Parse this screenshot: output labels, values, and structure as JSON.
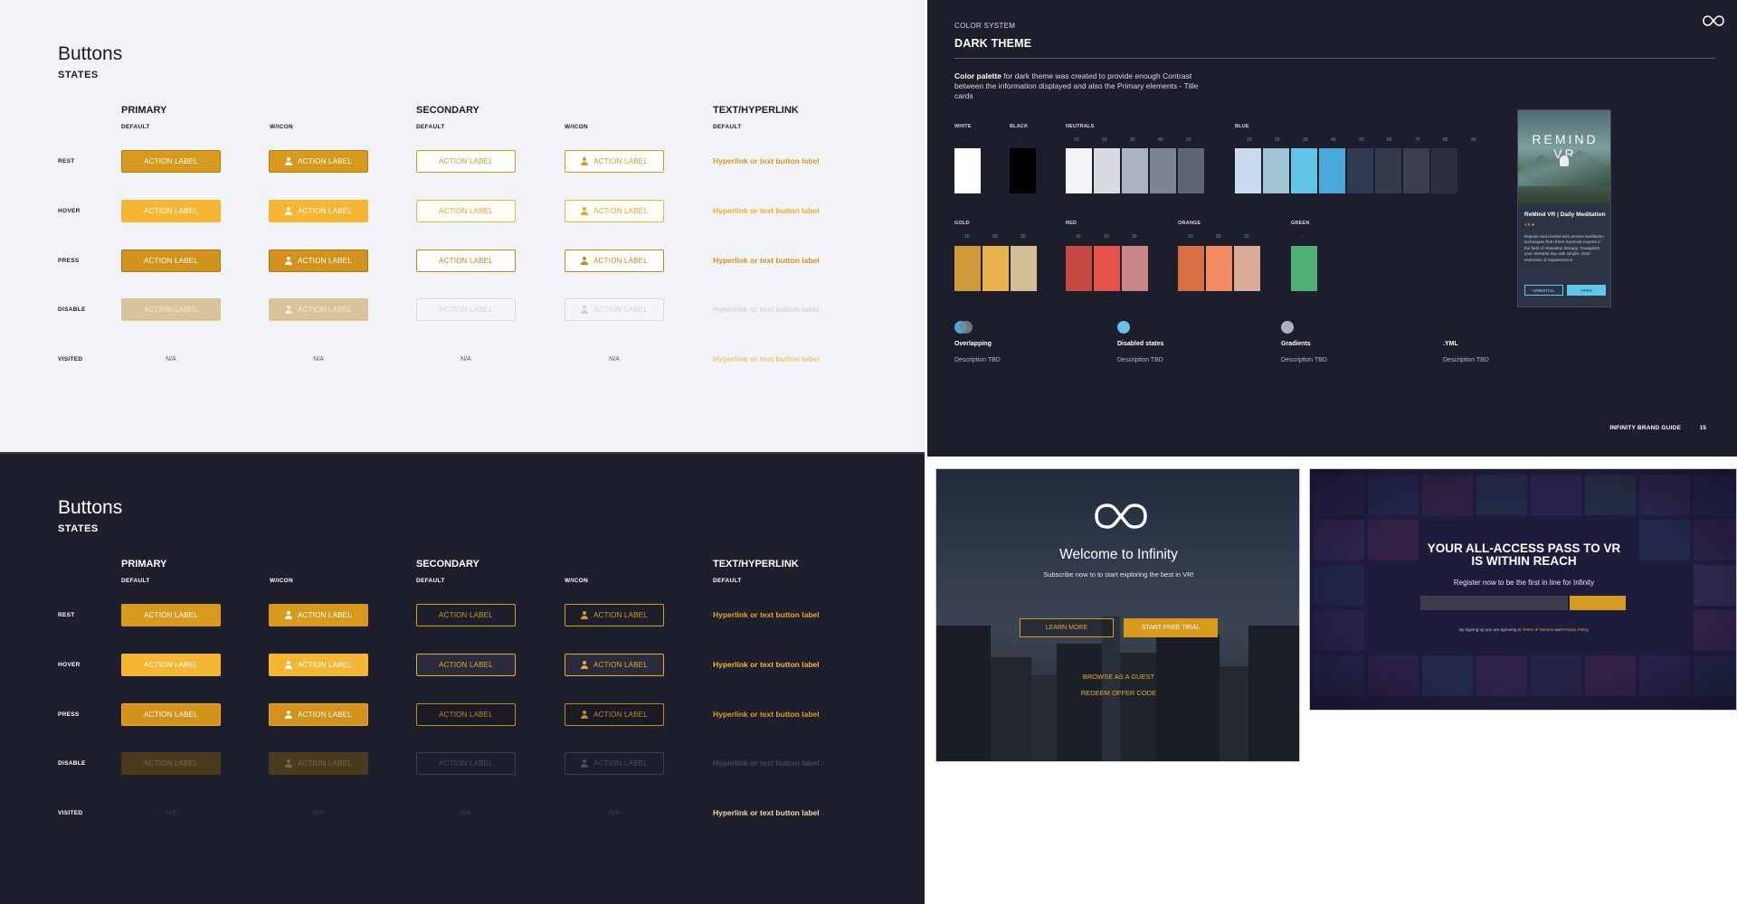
{
  "buttons_light": {
    "title": "Buttons",
    "subtitle": "STATES",
    "columns": {
      "primary": "PRIMARY",
      "primary_default": "DEFAULT",
      "primary_icon": "W/ICON",
      "secondary": "SECONDARY",
      "secondary_default": "DEFAULT",
      "secondary_icon": "W/ICON",
      "text": "TEXT/HYPERLINK",
      "text_default": "DEFAULT"
    },
    "rows": {
      "rest": "REST",
      "hover": "HOVER",
      "press": "PRESS",
      "disable": "DISABLE",
      "visited": "VISITED"
    },
    "action_label": "ACTION LABEL",
    "link_label": "Hyperlink or text button label",
    "na": "N/A"
  },
  "buttons_dark": {
    "title": "Buttons",
    "subtitle": "STATES",
    "columns": {
      "primary": "PRIMARY",
      "primary_default": "DEFAULT",
      "primary_icon": "W/ICON",
      "secondary": "SECONDARY",
      "secondary_default": "DEFAULT",
      "secondary_icon": "W/ICON",
      "text": "TEXT/HYPERLINK",
      "text_default": "DEFAULT"
    },
    "rows": {
      "rest": "REST",
      "hover": "HOVER",
      "press": "PRESS",
      "disable": "DISABLE",
      "visited": "VISITED"
    },
    "action_label": "ACTION LABEL",
    "link_label": "Hyperlink or text button label",
    "na": "N/A"
  },
  "color_system": {
    "kicker": "COLOR SYSTEM",
    "title": "DARK THEME",
    "desc_bold": "Color palette",
    "desc_rest": " for dark theme was created to provide enough Contrast between the information displayed and also the Primary elements - Title cards",
    "groups": {
      "white": "WHITE",
      "black": "BLACK",
      "neutrals": "NEUTRALS",
      "blue": "BLUE",
      "gold": "GOLD",
      "red": "RED",
      "orange": "ORANGE",
      "green": "GREEN"
    },
    "ticks": {
      "dash": "-",
      "t10": "10",
      "t20": "20",
      "t30": "30",
      "t40": "40",
      "t50": "50",
      "t60": "60",
      "t70": "70",
      "t80": "80",
      "t90": "90"
    },
    "colors": {
      "white": "#ffffff",
      "black": "#000000",
      "neutrals": [
        "#f4f5f8",
        "#d9dbe2",
        "#a9b2bf",
        "#7b8592",
        "#5c6573"
      ],
      "blue": [
        "#c9dcef",
        "#a1c4d2",
        "#63c4e8",
        "#4aa9d9",
        "#2e3a4f",
        "#333a4b",
        "#3b3e4e",
        "#2d2f3e"
      ],
      "gold": [
        "#cf9b3a",
        "#e8b24a",
        "#d2be94"
      ],
      "red": [
        "#c44a43",
        "#e6514a",
        "#c98686"
      ],
      "orange": [
        "#d76f45",
        "#f18c62",
        "#d9ab96"
      ],
      "green": [
        "#4fae74"
      ]
    },
    "legend": [
      {
        "label": "Overlapping",
        "desc": "Description TBD"
      },
      {
        "label": "Disabled states",
        "desc": "Description TBD"
      },
      {
        "label": "Gradients",
        "desc": "Description TBD"
      },
      {
        "label": ".YML",
        "desc": "Description TBD"
      }
    ],
    "card": {
      "art_text": "REMIND VR",
      "name": "ReMind VR | Daily Meditation",
      "rating": "4.5 ★",
      "text": "Repose and unwind with proven meditation techniques from three foremost experts in the field of relaxation therapy. Tranquilize your stressful day with simple, short exercises of requiescence.",
      "uninstall": "UNINSTALL",
      "open": "OPEN"
    },
    "footer": "INFINITY BRAND GUIDE",
    "page": "15"
  },
  "welcome": {
    "title": "Welcome to Infinity",
    "subtitle": "Subscribe now to to start exploring the best in VR!",
    "learn_more": "LEARN MORE",
    "start_trial": "START FREE TRIAL",
    "guest": "BROWSE AS A GUEST",
    "redeem": "REDEEM OFFER CODE"
  },
  "all_access": {
    "title_line1": "YOUR ALL-ACCESS PASS TO VR",
    "title_line2": "IS WITHIN REACH",
    "subtitle": "Register now to be the first in line for Infinity",
    "terms_a": "By signing up you are agreeing to ",
    "terms_link1": "Terms of Service",
    "terms_and": " and ",
    "terms_link2": "Privacy Policy"
  }
}
